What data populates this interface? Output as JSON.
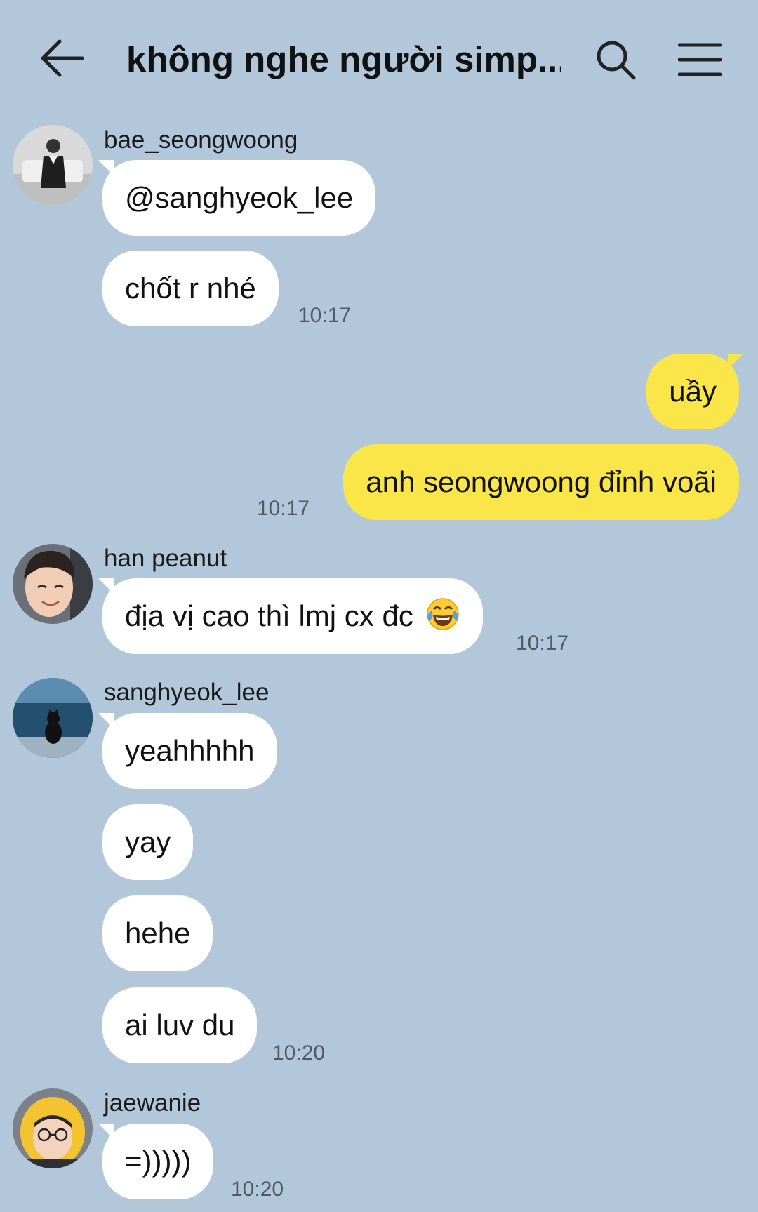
{
  "header": {
    "title": "không nghe người simp...",
    "back_icon": "arrow-left-icon",
    "search_icon": "search-icon",
    "menu_icon": "hamburger-menu-icon"
  },
  "colors": {
    "background": "#b2c7da",
    "incoming_bubble": "#ffffff",
    "outgoing_bubble": "#fbe64a",
    "timestamp": "#4f5a66"
  },
  "messages": [
    {
      "sender": "bae_seongwoong",
      "avatar": "man-in-suit-photo",
      "bubbles": [
        "@sanghyeok_lee",
        "chốt r nhé"
      ],
      "time": "10:17"
    },
    {
      "sender": "me",
      "bubbles": [
        "uầy",
        "anh seongwoong đỉnh voãi"
      ],
      "time": "10:17"
    },
    {
      "sender": "han peanut",
      "avatar": "smiling-boy-photo",
      "bubbles": [
        "địa vị cao thì lmj cx đc"
      ],
      "emoji": "tears-of-joy-emoji",
      "time": "10:17"
    },
    {
      "sender": "sanghyeok_lee",
      "avatar": "cat-by-sea-photo",
      "bubbles": [
        "yeahhhhh",
        "yay",
        "hehe",
        "ai luv du"
      ],
      "time": "10:20"
    },
    {
      "sender": "jaewanie",
      "avatar": "yellow-hood-photo",
      "bubbles": [
        "=)))))"
      ],
      "time": "10:20"
    }
  ]
}
